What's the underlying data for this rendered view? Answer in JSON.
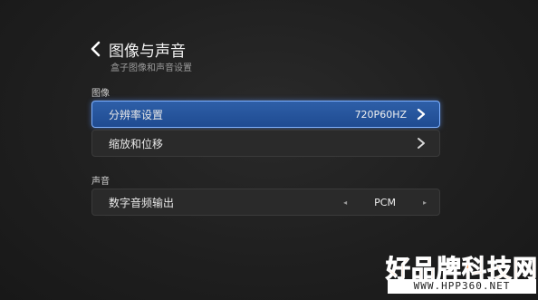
{
  "header": {
    "back_icon": "chevron-left-icon",
    "title": "图像与声音",
    "subtitle": "盒子图像和声音设置"
  },
  "sections": {
    "image": {
      "label": "图像",
      "items": [
        {
          "label": "分辨率设置",
          "value": "720P60HZ",
          "selected": true,
          "icon": "chevron-right-icon"
        },
        {
          "label": "缩放和位移",
          "value": "",
          "selected": false,
          "icon": "chevron-right-icon"
        }
      ]
    },
    "sound": {
      "label": "声音",
      "items": [
        {
          "label": "数字音频输出",
          "value": "PCM",
          "selected": false,
          "left_icon": "arrow-left-icon",
          "right_icon": "arrow-right-icon"
        }
      ]
    }
  },
  "watermark": {
    "title": "好品牌科技网",
    "url": "WWW.HPP360.NET"
  },
  "colors": {
    "background": "#1f1f1f",
    "row_bg": "#2a2a2a",
    "selected_bg": "#1f4b91",
    "selected_border": "#7fb1ff",
    "watermark": "#ff7a1a"
  }
}
